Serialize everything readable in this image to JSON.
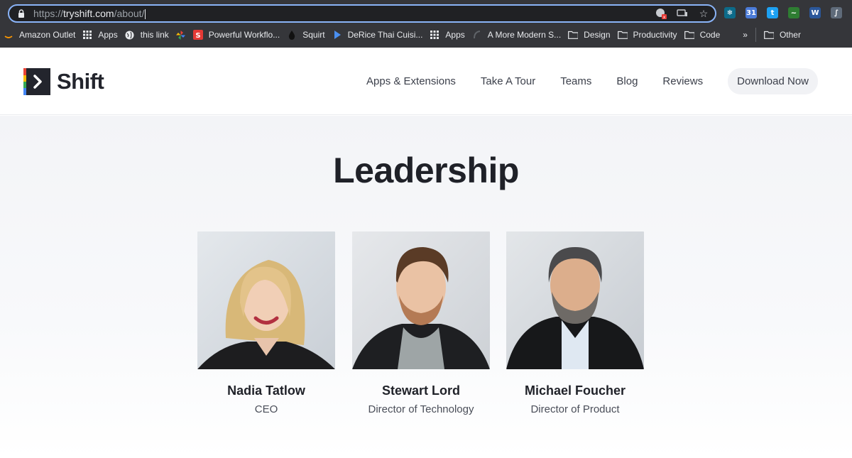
{
  "browser": {
    "url_scheme": "https://",
    "url_host": "tryshift.com",
    "url_path": "/about/",
    "omnibox_icons": [
      "ad-blocker-icon",
      "cast-icon",
      "bookmark-star-icon"
    ],
    "extensions": [
      {
        "icon": "snowflake-extension-icon",
        "glyph": "❄",
        "color": "#0d6b8a"
      },
      {
        "icon": "calendar-extension-icon",
        "glyph": "31",
        "color": "#4a7bd8"
      },
      {
        "icon": "twitter-extension-icon",
        "glyph": "t",
        "color": "#1da1f2"
      },
      {
        "icon": "chart-extension-icon",
        "glyph": "~",
        "color": "#2e7d32"
      },
      {
        "icon": "word-extension-icon",
        "glyph": "W",
        "color": "#2b579a"
      },
      {
        "icon": "feather-extension-icon",
        "glyph": "∫",
        "color": "#5f6b7a"
      }
    ],
    "bookmarks": [
      {
        "label": "Amazon Outlet",
        "icon": "amazon-icon"
      },
      {
        "label": "Apps",
        "icon": "apps-grid-icon"
      },
      {
        "label": "this link",
        "icon": "globe-icon"
      },
      {
        "label": "",
        "icon": "pinwheel-icon"
      },
      {
        "label": "Powerful Workflo...",
        "icon": "workflow-icon"
      },
      {
        "label": "Squirt",
        "icon": "droplet-icon"
      },
      {
        "label": "DeRice Thai Cuisi...",
        "icon": "play-icon"
      },
      {
        "label": "Apps",
        "icon": "apps-grid-icon"
      },
      {
        "label": "A More Modern S...",
        "icon": "curve-icon"
      },
      {
        "label": "Design",
        "icon": "folder-icon"
      },
      {
        "label": "Productivity",
        "icon": "folder-icon"
      },
      {
        "label": "Code",
        "icon": "folder-icon"
      }
    ],
    "overflow_label": "»",
    "other_bookmarks_label": "Other"
  },
  "site": {
    "logo_text": "Shift",
    "nav": [
      "Apps & Extensions",
      "Take A Tour",
      "Teams",
      "Blog",
      "Reviews"
    ],
    "cta_label": "Download Now"
  },
  "page": {
    "heading": "Leadership",
    "team": [
      {
        "name": "Nadia Tatlow",
        "role": "CEO"
      },
      {
        "name": "Stewart Lord",
        "role": "Director of Technology"
      },
      {
        "name": "Michael Foucher",
        "role": "Director of Product"
      }
    ]
  },
  "colors": {
    "chrome_bg": "#35363a",
    "omnibox_focus": "#8ab4f8",
    "heading": "#1f2128",
    "logo_dark": "#23252d"
  }
}
